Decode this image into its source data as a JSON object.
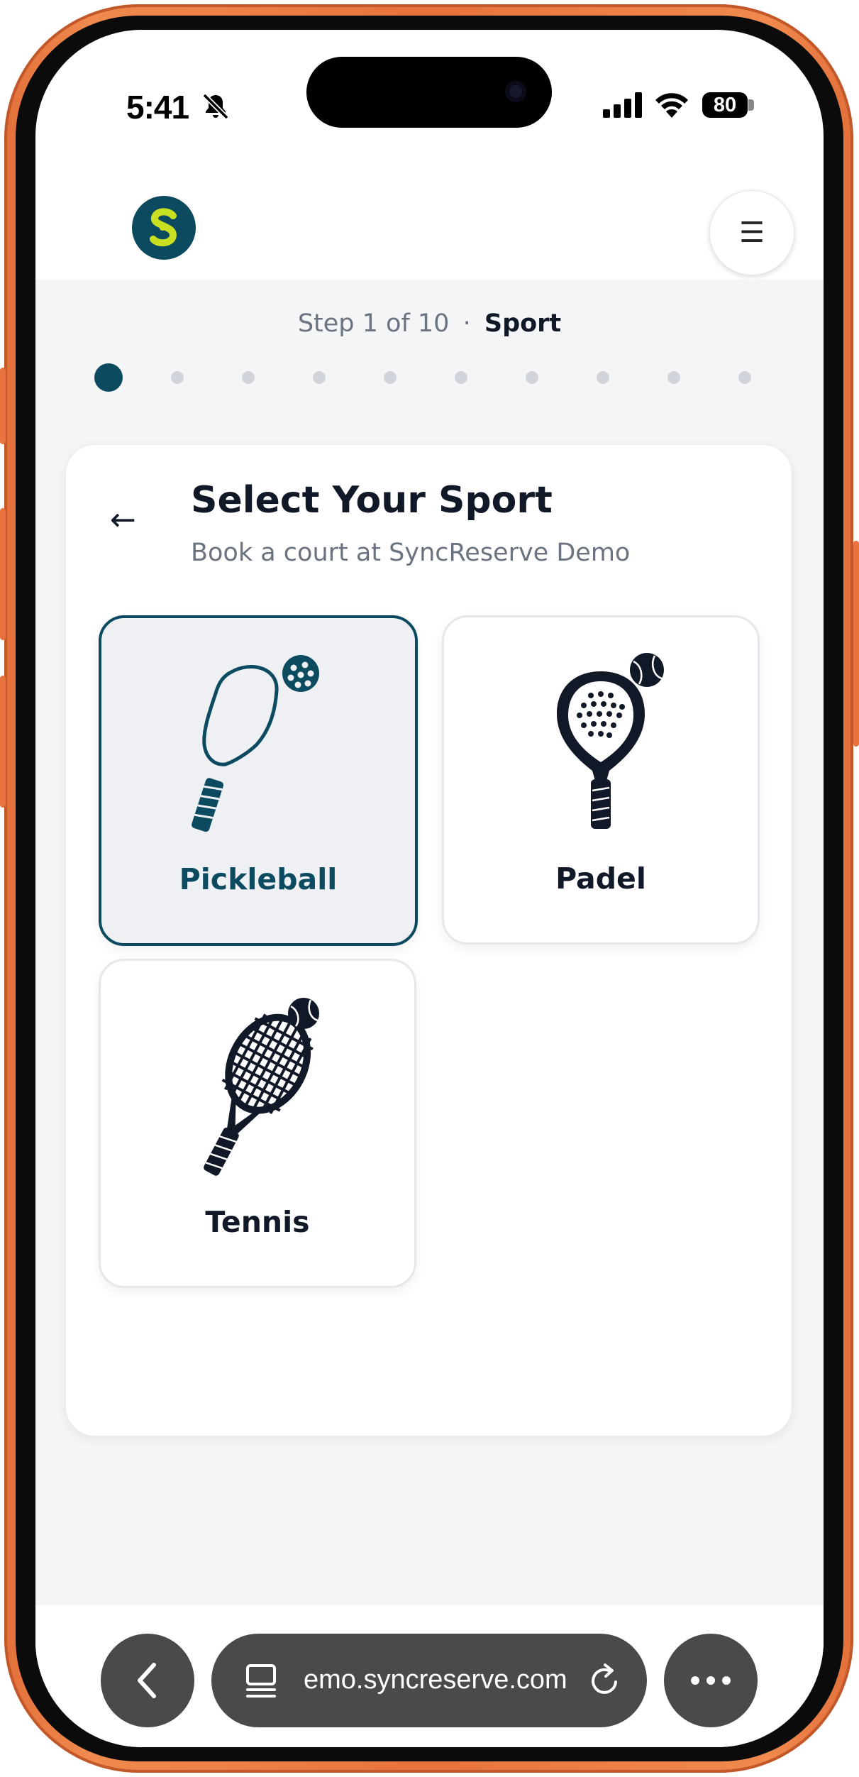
{
  "status_bar": {
    "time": "5:41",
    "battery": "80"
  },
  "header": {
    "logo_letter": "S",
    "menu_icon": "☰"
  },
  "progress": {
    "step_text": "Step 1 of 10",
    "separator": "·",
    "step_name": "Sport",
    "total_steps": 10,
    "current_step": 1
  },
  "card": {
    "back_icon": "←",
    "title": "Select Your Sport",
    "subtitle": "Book a court at SyncReserve Demo"
  },
  "sports": [
    {
      "label": "Pickleball",
      "icon": "pickleball-paddle-icon",
      "selected": true
    },
    {
      "label": "Padel",
      "icon": "padel-racket-icon",
      "selected": false
    },
    {
      "label": "Tennis",
      "icon": "tennis-racket-icon",
      "selected": false
    }
  ],
  "browser": {
    "url": "emo.syncreserve.com"
  },
  "colors": {
    "primary": "#0c4a60",
    "logo_accent": "#c8e021",
    "frame": "#e8733d"
  }
}
